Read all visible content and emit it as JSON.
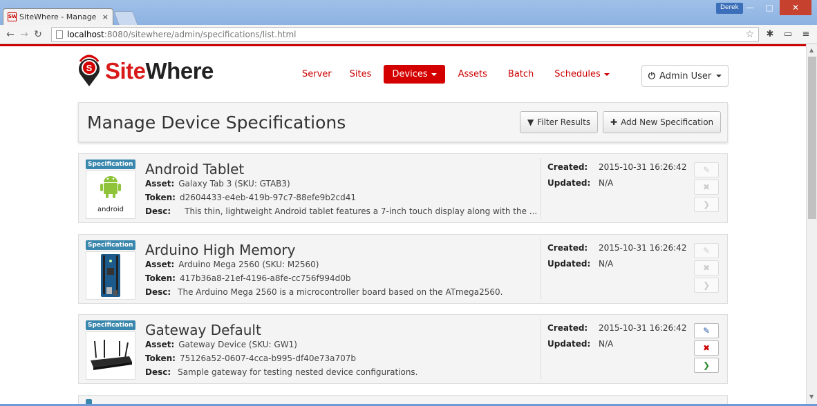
{
  "browser": {
    "tab_title": "SiteWhere - Manage",
    "tab_close": "×",
    "favicon_text": "SW",
    "user_chip": "Derek",
    "url_host": "localhost",
    "url_path": ":8080/sitewhere/admin/specifications/list.html"
  },
  "brand": {
    "site": "Site",
    "where": "Where"
  },
  "nav": {
    "items": [
      "Server",
      "Sites",
      "Devices",
      "Assets",
      "Batch",
      "Schedules"
    ],
    "active": "Devices"
  },
  "admin_button": "Admin User",
  "header": {
    "title": "Manage Device Specifications",
    "filter_label": "Filter Results",
    "add_label": "Add New Specification"
  },
  "labels": {
    "badge": "Specification",
    "asset": "Asset:",
    "token": "Token:",
    "desc": "Desc:",
    "created": "Created:",
    "updated": "Updated:"
  },
  "specs": [
    {
      "name": "Android Tablet",
      "asset": "Galaxy Tab 3 (SKU: GTAB3)",
      "token": "d2604433-e4eb-419b-97c7-88efe9b2cd41",
      "desc": "This thin, lightweight Android tablet features a 7-inch touch display along with the ...",
      "created": "2015-10-31 16:26:42",
      "updated": "N/A",
      "image": "android-logo",
      "image_text": "android",
      "actions_enabled": false
    },
    {
      "name": "Arduino High Memory",
      "asset": "Arduino Mega 2560 (SKU: M2560)",
      "token": "417b36a8-21ef-4196-a8fe-cc756f994d0b",
      "desc": "The Arduino Mega 2560 is a microcontroller board based on the ATmega2560.",
      "created": "2015-10-31 16:26:42",
      "updated": "N/A",
      "image": "arduino-board",
      "actions_enabled": false
    },
    {
      "name": "Gateway Default",
      "asset": "Gateway Device (SKU: GW1)",
      "token": "75126a52-0607-4cca-b995-df40e73a707b",
      "desc": "Sample gateway for testing nested device configurations.",
      "created": "2015-10-31 16:26:42",
      "updated": "N/A",
      "image": "gateway-router",
      "actions_enabled": true
    }
  ],
  "colors": {
    "brand_red": "#d40000",
    "badge_blue": "#3a87ad",
    "window_blue": "#8db2e2"
  }
}
